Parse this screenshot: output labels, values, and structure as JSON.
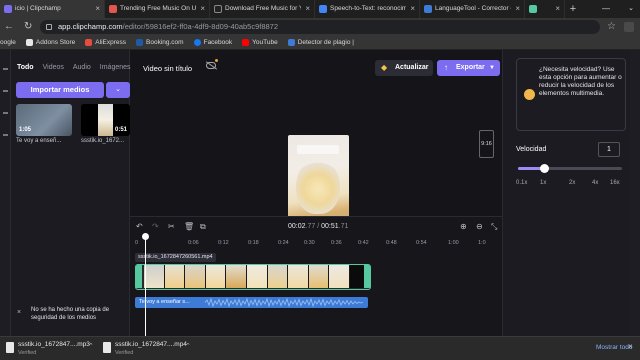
{
  "browser": {
    "tabs": [
      {
        "label": "icio | Clipchamp",
        "color": "#7b6cf0",
        "active": true
      },
      {
        "label": "Trending Free Music On Upp",
        "color": "#e2574c",
        "active": false
      },
      {
        "label": "Download Free Music for Yo",
        "color": "#222222",
        "active": false
      },
      {
        "label": "Speech-to-Text: reconocimi",
        "color": "#4285f4",
        "active": false
      },
      {
        "label": "LanguageTool - Corrector or",
        "color": "#3d7bd6",
        "active": false
      },
      {
        "label": "",
        "color": "#57c9a0",
        "active": false
      }
    ],
    "url_host": "app.clipchamp.com",
    "url_rest": "/editor/59816ef2-ff0a-4df9-8d09-40ab5c9f8872",
    "bookmarks": [
      {
        "label": "oogle",
        "color": "#4285f4"
      },
      {
        "label": "Addons Store",
        "color": "#e8e8e8"
      },
      {
        "label": "AliExpress",
        "color": "#e84c3d"
      },
      {
        "label": "Booking.com",
        "color": "#1f5aa6"
      },
      {
        "label": "Facebook",
        "color": "#1877f2"
      },
      {
        "label": "YouTube",
        "color": "#ff0000"
      },
      {
        "label": "Detector de plagio |",
        "color": "#3d7bd6"
      }
    ]
  },
  "media_panel": {
    "tabs": [
      "Todo",
      "Videos",
      "Audio",
      "Imágenes"
    ],
    "import_label": "Importar medios",
    "items": [
      {
        "duration": "1:05",
        "caption": "Te voy a enseñ..."
      },
      {
        "duration": "0:51",
        "caption": "ssstik.io_1672..."
      }
    ],
    "notice": "No se ha hecho una copia de seguridad de los medios"
  },
  "toolbar": {
    "video_title": "Video sin título",
    "upgrade_label": "Actualizar",
    "export_label": "Exportar"
  },
  "preview": {
    "aspect_ratio": "9:16"
  },
  "timeline": {
    "current_time": "00:02",
    "current_frac": ".77",
    "separator": " / ",
    "total_time": "00:51",
    "total_frac": ".71",
    "ruler_ticks": [
      "0",
      "0:06",
      "0:12",
      "0:18",
      "0:24",
      "0:30",
      "0:36",
      "0:42",
      "0:48",
      "0:54",
      "1:00",
      "1:0"
    ],
    "video_clip_label": "ssstik.io_1672847260561.mp4",
    "audio_clip_label": "Te voy a enseñar s..."
  },
  "speed_panel": {
    "tip": "¿Necesita velocidad? Use esta opción para aumentar o reducir la velocidad de los elementos multimedia.",
    "label": "Velocidad",
    "value": "1",
    "slider_fraction": 0.25,
    "scale_labels": [
      "0.1x",
      "1x",
      "2x",
      "4x",
      "16x"
    ]
  },
  "downloads": {
    "items": [
      {
        "name": "ssstik.io_1672847....mp3",
        "status": "Verified"
      },
      {
        "name": "ssstik.io_1672847....mp4",
        "status": "Verified"
      }
    ],
    "show_all_label": "Mostrar todo"
  },
  "colors": {
    "accent": "#7b6cf0",
    "clip_border": "#57c9a0",
    "audio_clip": "#3d7bd6"
  }
}
